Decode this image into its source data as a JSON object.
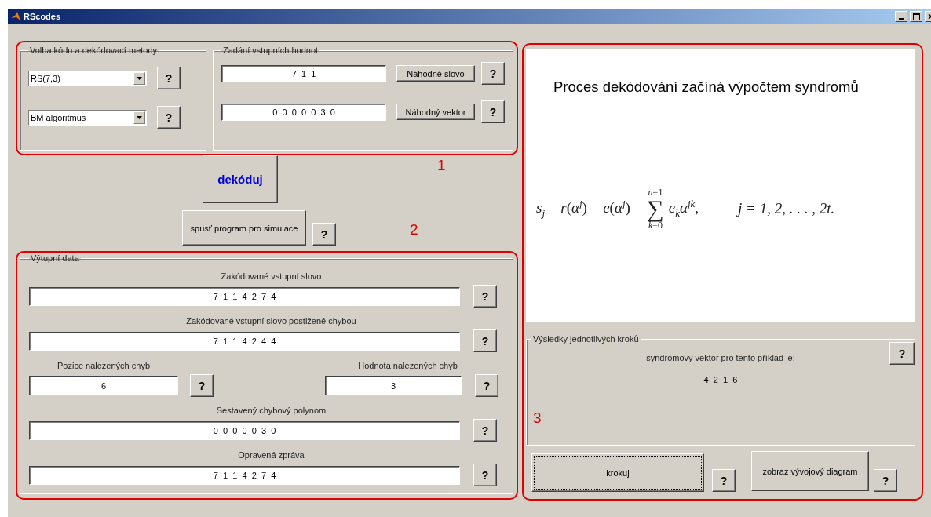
{
  "window": {
    "title": "RScodes"
  },
  "code_group": {
    "title": "Volba kódu a dekódovací metody",
    "selects": [
      {
        "value": "RS(7,3)",
        "help": "?"
      },
      {
        "value": "BM algoritmus",
        "help": "?"
      }
    ]
  },
  "input_group": {
    "title": "Zadání vstupních hodnot",
    "rows": [
      {
        "value": "7  1  1",
        "button": "Náhodné slovo",
        "help": "?"
      },
      {
        "value": "0  0  0  0  0  3  0",
        "button": "Náhodný vektor",
        "help": "?"
      }
    ]
  },
  "decode_button": "dekóduj",
  "simulation": {
    "button": "spusť program pro simulace",
    "help": "?"
  },
  "output_group": {
    "title": "Výtupní data",
    "rows": [
      {
        "kind": "wide",
        "label": "Zakódované vstupní slovo",
        "value": "7  1  1  4  2  7  4",
        "help": "?"
      },
      {
        "kind": "wide",
        "label": "Zakódované vstupní slovo postižené chybou",
        "value": "7  1  1  4  2  4  4",
        "help": "?"
      },
      {
        "kind": "pair",
        "left": {
          "label": "Pozice nalezených chyb",
          "value": "6",
          "help": "?"
        },
        "right": {
          "label": "Hodnota nalezených chyb",
          "value": "3",
          "help": "?"
        }
      },
      {
        "kind": "wide",
        "label": "Sestavený chybový polynom",
        "value": "0  0  0  0  0  3  0",
        "help": "?"
      },
      {
        "kind": "wide",
        "label": "Opravená zpráva",
        "value": "7  1  1  4  2  7  4",
        "help": "?"
      }
    ]
  },
  "display": {
    "caption": "Proces dekódování začíná výpočtem syndromů",
    "formula": {
      "lhs": "*s*$_{j}$ = *r*(*α*$^{j}$) = *e*(*α*$^{j}$) =",
      "sum_upper": "*n*−1",
      "sum_symbol": "∑",
      "sum_lower": "*k*=0",
      "term": "*e*$_{k}$*α*$^{jk}$,",
      "condition": "j = 1, 2, . . . , 2t."
    }
  },
  "results_group": {
    "title": "Výsledky jednotlivých kroků",
    "help": "?",
    "text": "syndromovy vektor pro tento příklad je:",
    "value": "4  2  1  6"
  },
  "step_button": {
    "label": "krokuj",
    "focused": true,
    "help": "?"
  },
  "diagram_button": {
    "label": "zobraz vývojový diagram",
    "help": "?"
  },
  "annotations": [
    "1",
    "2",
    "3"
  ]
}
